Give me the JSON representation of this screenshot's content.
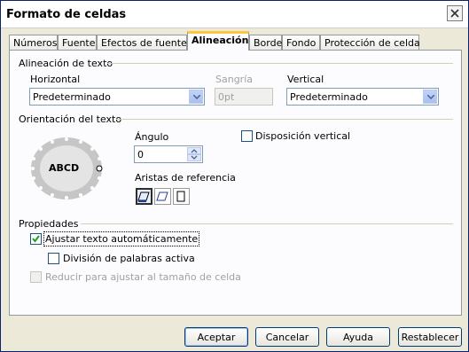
{
  "window": {
    "title": "Formato de celdas"
  },
  "tabs": [
    "Números",
    "Fuente",
    "Efectos de fuente",
    "Alineación",
    "Borde",
    "Fondo",
    "Protección de celda"
  ],
  "text_alignment": {
    "title": "Alineación de texto",
    "horizontal_label": "Horizontal",
    "horizontal_value": "Predeterminado",
    "indent_label": "Sangría",
    "indent_value": "0pt",
    "vertical_label": "Vertical",
    "vertical_value": "Predeterminado"
  },
  "orientation": {
    "title": "Orientación del texto",
    "dial_text": "ABCD",
    "angle_label": "Ángulo",
    "angle_value": "0",
    "edges_label": "Aristas de referencia",
    "vertical_layout_label": "Disposición vertical",
    "vertical_layout_checked": false
  },
  "properties": {
    "title": "Propiedades",
    "wrap_label": "Ajustar texto automáticamente",
    "wrap_checked": true,
    "hyphen_label": "División de palabras activa",
    "hyphen_checked": false,
    "shrink_label": "Reducir para ajustar al tamaño de celda",
    "shrink_checked": false
  },
  "buttons": {
    "ok": "Aceptar",
    "cancel": "Cancelar",
    "help": "Ayuda",
    "reset": "Restablecer"
  },
  "colors": {
    "accent_tab": "#ffc83c",
    "check": "#21a121",
    "frame": "#919b9c"
  }
}
